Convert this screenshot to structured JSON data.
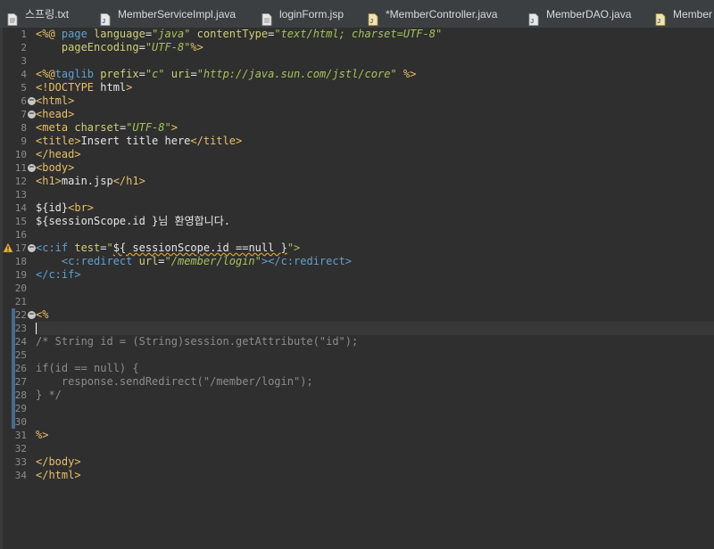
{
  "tabs": [
    {
      "label": "스프링.txt",
      "icon": "text-file-icon"
    },
    {
      "label": "MemberServiceImpl.java",
      "icon": "java-file-icon"
    },
    {
      "label": "loginForm.jsp",
      "icon": "jsp-file-icon"
    },
    {
      "label": "*MemberController.java",
      "icon": "java-class-icon"
    },
    {
      "label": "MemberDAO.java",
      "icon": "java-file-icon"
    },
    {
      "label": "Member",
      "icon": "java-class-icon"
    }
  ],
  "colors": {
    "background": "#2f2f2f",
    "tag": "#e8bf6a",
    "jstl_tag": "#60a0d0",
    "attribute": "#cfcf7a",
    "string": "#a5c25c",
    "comment": "#8c8c8c",
    "warning": "#e8b33a"
  },
  "editor": {
    "line_numbers": [
      "1",
      "2",
      "3",
      "4",
      "5",
      "6",
      "7",
      "8",
      "9",
      "10",
      "11",
      "12",
      "13",
      "14",
      "15",
      "16",
      "17",
      "18",
      "19",
      "20",
      "21",
      "22",
      "23",
      "24",
      "25",
      "26",
      "27",
      "28",
      "29",
      "30",
      "31",
      "32",
      "33",
      "34"
    ],
    "lines": [
      [
        {
          "t": "<%@ ",
          "c": "dir"
        },
        {
          "t": "page ",
          "c": "tag2"
        },
        {
          "t": "language",
          "c": "attr"
        },
        {
          "t": "=",
          "c": "text"
        },
        {
          "t": "\"java\"",
          "c": "str"
        },
        {
          "t": " contentType",
          "c": "attr"
        },
        {
          "t": "=",
          "c": "text"
        },
        {
          "t": "\"text/html; charset=UTF-8\"",
          "c": "str"
        }
      ],
      [
        {
          "t": "    pageEncoding",
          "c": "attr"
        },
        {
          "t": "=",
          "c": "text"
        },
        {
          "t": "\"UTF-8\"",
          "c": "str"
        },
        {
          "t": "%>",
          "c": "dir"
        }
      ],
      [],
      [
        {
          "t": "<%@",
          "c": "dir"
        },
        {
          "t": "taglib ",
          "c": "tag2"
        },
        {
          "t": "prefix",
          "c": "attr"
        },
        {
          "t": "=",
          "c": "text"
        },
        {
          "t": "\"c\"",
          "c": "str"
        },
        {
          "t": " uri",
          "c": "attr"
        },
        {
          "t": "=",
          "c": "text"
        },
        {
          "t": "\"http://java.sun.com/jstl/core\"",
          "c": "str"
        },
        {
          "t": " %>",
          "c": "dir"
        }
      ],
      [
        {
          "t": "<!DOCTYPE ",
          "c": "tag"
        },
        {
          "t": "html",
          "c": "text"
        },
        {
          "t": ">",
          "c": "tag"
        }
      ],
      [
        {
          "t": "<html>",
          "c": "tag"
        }
      ],
      [
        {
          "t": "<head>",
          "c": "tag"
        }
      ],
      [
        {
          "t": "<meta ",
          "c": "tag"
        },
        {
          "t": "charset",
          "c": "attr"
        },
        {
          "t": "=",
          "c": "text"
        },
        {
          "t": "\"UTF-8\"",
          "c": "str"
        },
        {
          "t": ">",
          "c": "tag"
        }
      ],
      [
        {
          "t": "<title>",
          "c": "tag"
        },
        {
          "t": "Insert title here",
          "c": "text"
        },
        {
          "t": "</title>",
          "c": "tag"
        }
      ],
      [
        {
          "t": "</head>",
          "c": "tag"
        }
      ],
      [
        {
          "t": "<body>",
          "c": "tag"
        }
      ],
      [
        {
          "t": "<h1>",
          "c": "tag"
        },
        {
          "t": "main.jsp",
          "c": "text"
        },
        {
          "t": "</h1>",
          "c": "tag"
        }
      ],
      [],
      [
        {
          "t": "${id}",
          "c": "text"
        },
        {
          "t": "<br>",
          "c": "tag"
        }
      ],
      [
        {
          "t": "${sessionScope.id }님 환영합니다.",
          "c": "text"
        }
      ],
      [],
      [
        {
          "t": "<c:if ",
          "c": "tag2"
        },
        {
          "t": "test",
          "c": "attr"
        },
        {
          "t": "=",
          "c": "text"
        },
        {
          "t": "\"",
          "c": "str"
        },
        {
          "t": "${ sessionScope.id ==null }",
          "c": "text",
          "sq": true
        },
        {
          "t": "\">",
          "c": "str"
        }
      ],
      [
        {
          "t": "    <c:redirect ",
          "c": "tag2"
        },
        {
          "t": "url",
          "c": "attr"
        },
        {
          "t": "=",
          "c": "text"
        },
        {
          "t": "\"/member/login\"",
          "c": "str"
        },
        {
          "t": "></c:redirect>",
          "c": "tag2"
        }
      ],
      [
        {
          "t": "</c:if>",
          "c": "tag2"
        }
      ],
      [],
      [],
      [
        {
          "t": "<%",
          "c": "dir"
        }
      ],
      [],
      [
        {
          "t": "/* String id = (String)session.getAttribute(\"id\");",
          "c": "comment"
        }
      ],
      [],
      [
        {
          "t": "if(id == null) {",
          "c": "comment"
        }
      ],
      [
        {
          "t": "    response.sendRedirect(\"/member/login\");",
          "c": "comment"
        }
      ],
      [
        {
          "t": "} */",
          "c": "comment"
        }
      ],
      [],
      [],
      [
        {
          "t": "%>",
          "c": "dir"
        }
      ],
      [],
      [
        {
          "t": "</body>",
          "c": "tag"
        }
      ],
      [
        {
          "t": "</html>",
          "c": "tag"
        }
      ]
    ],
    "fold_markers": [
      "6",
      "7",
      "11",
      "17",
      "22"
    ],
    "warning_line": "17",
    "modified_lines": [
      "22",
      "23",
      "24",
      "25",
      "26",
      "27",
      "28",
      "29",
      "30"
    ],
    "current_line": "23"
  }
}
